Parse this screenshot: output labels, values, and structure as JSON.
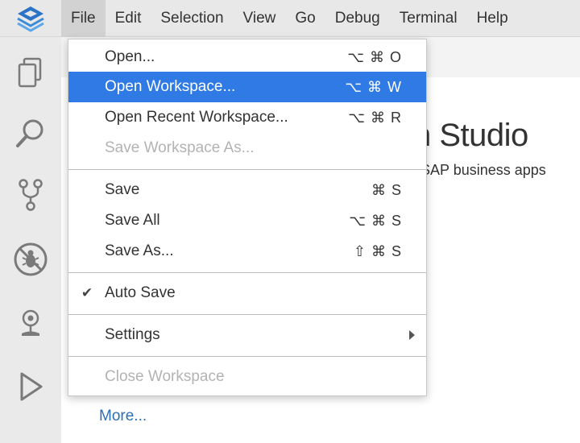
{
  "menubar": {
    "items": [
      {
        "label": "File",
        "active": true
      },
      {
        "label": "Edit"
      },
      {
        "label": "Selection"
      },
      {
        "label": "View"
      },
      {
        "label": "Go"
      },
      {
        "label": "Debug"
      },
      {
        "label": "Terminal"
      },
      {
        "label": "Help"
      }
    ]
  },
  "activitybar": {
    "icons": [
      "explorer-icon",
      "search-icon",
      "source-control-icon",
      "debug-icon",
      "plugins-icon",
      "run-icon"
    ]
  },
  "welcome": {
    "title": "n Studio",
    "subtitle": "SAP business apps",
    "more_link": "More..."
  },
  "file_menu": {
    "open": {
      "label": "Open...",
      "shortcut": "⌥ ⌘ O"
    },
    "open_workspace": {
      "label": "Open Workspace...",
      "shortcut": "⌥ ⌘ W"
    },
    "open_recent_workspace": {
      "label": "Open Recent Workspace...",
      "shortcut": "⌥ ⌘ R"
    },
    "save_workspace_as": {
      "label": "Save Workspace As..."
    },
    "save": {
      "label": "Save",
      "shortcut": "⌘ S"
    },
    "save_all": {
      "label": "Save All",
      "shortcut": "⌥ ⌘ S"
    },
    "save_as": {
      "label": "Save As...",
      "shortcut": "⇧ ⌘ S"
    },
    "auto_save": {
      "label": "Auto Save",
      "checked": true,
      "check_glyph": "✔"
    },
    "settings": {
      "label": "Settings"
    },
    "close_workspace": {
      "label": "Close Workspace"
    }
  },
  "colors": {
    "highlight": "#2f7ae5",
    "link": "#2c6fb5",
    "menubar_bg": "#e8e8e8",
    "activitybar_bg": "#eaeaea"
  }
}
